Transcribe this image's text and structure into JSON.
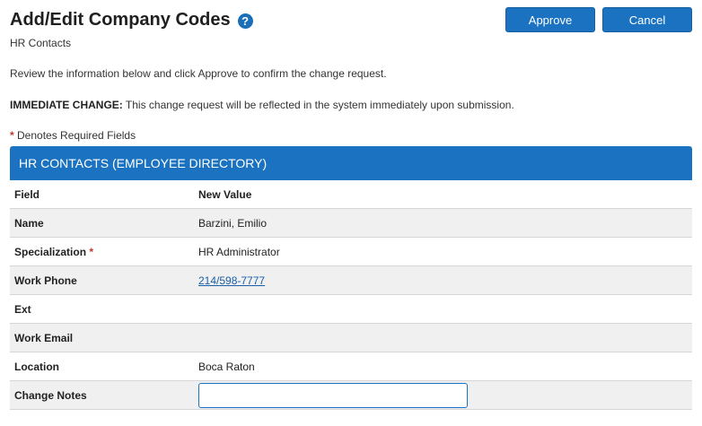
{
  "header": {
    "title": "Add/Edit Company Codes",
    "help_icon": "?",
    "subtitle": "HR Contacts",
    "approve_label": "Approve",
    "cancel_label": "Cancel"
  },
  "instructions": "Review the information below and click Approve to confirm the change request.",
  "notice": {
    "label": "IMMEDIATE CHANGE:",
    "text": " This change request will be reflected in the system immediately upon submission."
  },
  "required_note": {
    "asterisk": "*",
    "text": " Denotes Required Fields"
  },
  "panel": {
    "title": "HR CONTACTS (EMPLOYEE DIRECTORY)",
    "columns": {
      "field": "Field",
      "value": "New Value"
    },
    "rows": [
      {
        "field": "Name",
        "value": "Barzini, Emilio"
      },
      {
        "field": "Specialization",
        "required": "*",
        "value": "HR Administrator"
      },
      {
        "field": "Work Phone",
        "value": "214/598-7777"
      },
      {
        "field": "Ext",
        "value": ""
      },
      {
        "field": "Work Email",
        "value": ""
      },
      {
        "field": "Location",
        "value": "Boca Raton"
      }
    ],
    "notes": {
      "label": "Change Notes",
      "value": "",
      "placeholder": ""
    }
  },
  "colors": {
    "accent": "#1a72c0",
    "required": "#c0392b",
    "link": "#1a5fa8"
  }
}
